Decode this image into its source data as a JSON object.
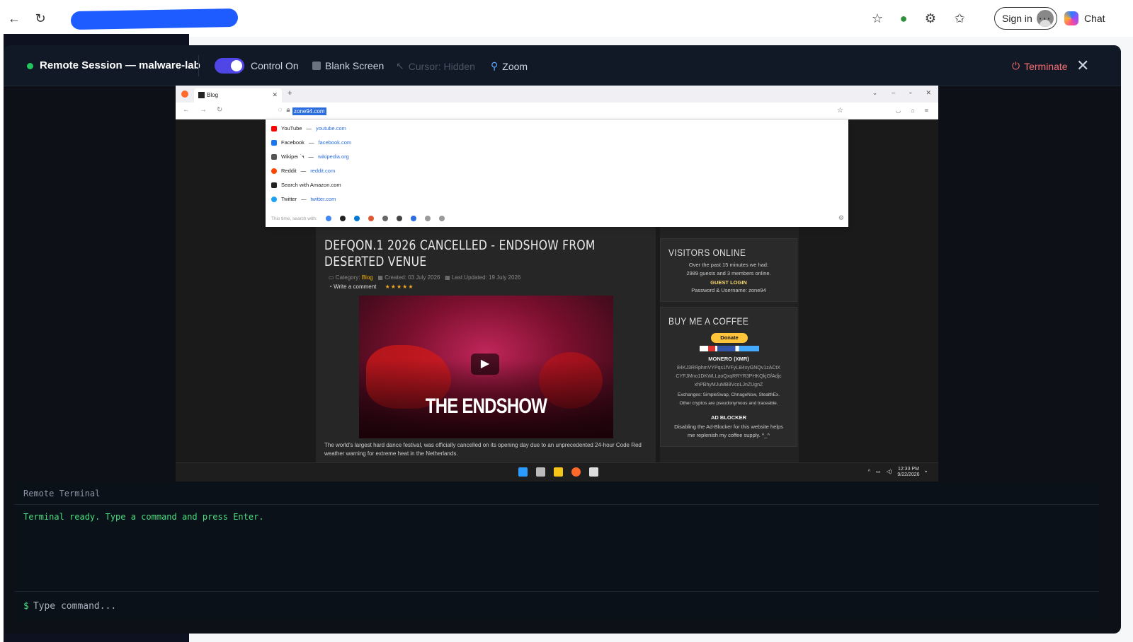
{
  "host": {
    "signin_label": "Sign in",
    "chat_label": "Chat",
    "icons": [
      "back-icon",
      "refresh-icon",
      "lock-icon",
      "favorite-icon",
      "browser-essentials-icon",
      "extensions-icon",
      "favorites-list-icon",
      "more-icon",
      "copilot-icon"
    ]
  },
  "modal": {
    "title": "Remote Session — malware-lab",
    "control_label": "Control On",
    "blank_label": "Blank Screen",
    "cursor_label": "Cursor: Hidden",
    "zoom_label": "Zoom",
    "terminate_label": "Terminate",
    "status_color": "#22c55e",
    "accent": "#4f46e5",
    "danger": "#f87171"
  },
  "remote": {
    "tab_label": "Blog",
    "url": "zone94.com",
    "suggestions": [
      {
        "name": "YouTube",
        "url": "youtube.com",
        "color": "#ff0000"
      },
      {
        "name": "Facebook",
        "url": "facebook.com",
        "color": "#1877f2"
      },
      {
        "name": "Wikipedia",
        "url": "wikipedia.org",
        "color": "#555555"
      },
      {
        "name": "Reddit",
        "url": "reddit.com",
        "color": "#ff4500"
      },
      {
        "name": "Search with Amazon.com",
        "url": "",
        "color": "#222222"
      },
      {
        "name": "Twitter",
        "url": "twitter.com",
        "color": "#1da1f2"
      }
    ],
    "search_with_label": "This time, search with:",
    "article": {
      "title": "DEFQON.1 2026 CANCELLED - ENDSHOW FROM DESERTED VENUE",
      "category_label": "Category:",
      "category": "Blog",
      "created": "Created: 03 July 2026",
      "updated": "Last Updated: 19 July 2026",
      "comment_label": "Write a comment",
      "stars": "★★★★★",
      "video_title": "THE ENDSHOW",
      "body": "The world's largest hard dance festival, was officially cancelled on its opening day due to an unprecedented 24-hour Code Red weather warning for extreme heat in the Netherlands."
    },
    "visitors": {
      "title": "VISITORS ONLINE",
      "line1": "Over the past 15 minutes we had:",
      "line2": "2989 guests and 3 members online.",
      "guest_login": "GUEST LOGIN",
      "credentials": "Password & Username: zone94"
    },
    "coffee": {
      "title": "BUY ME A COFFEE",
      "donate": "Donate",
      "monero_label": "MONERO (XMR)",
      "addr1": "84KJ3RRphmVYPqs1fVFyLB4xyGNQv1zACtX",
      "addr2": "CYFJMno1DKWLLaoQxqRRYR3PHKQkjGfAdjc",
      "addr3": "xhPBhyMJuMB8VcoLJnZUgnZ",
      "exchanges": "Exchanges: SimpleSwap, ChnageNow, StealthEx.",
      "other": "Other cryptos are pseudonymous and traceable.",
      "adblock_title": "AD BLOCKER",
      "adblock1": "Disabling the Ad-Blocker for this website helps",
      "adblock2": "me replenish my coffee supply. ^_^"
    },
    "clock_time": "12:33 PM",
    "clock_date": "9/22/2026"
  },
  "terminal": {
    "title": "Remote Terminal",
    "output": "Terminal ready. Type a command and press Enter.",
    "prompt": "$",
    "placeholder": "Type command..."
  }
}
